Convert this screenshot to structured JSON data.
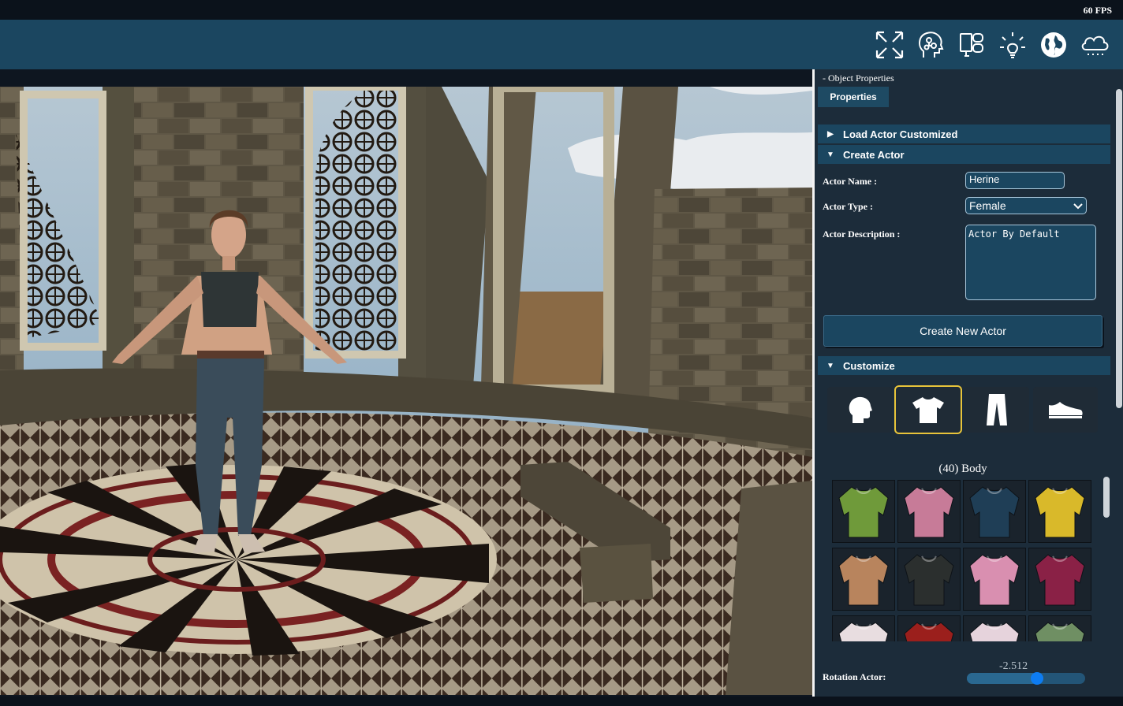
{
  "status": {
    "fps": "60 FPS"
  },
  "toolbar": {
    "tools": [
      {
        "name": "fullscreen-icon"
      },
      {
        "name": "ai-brain-icon"
      },
      {
        "name": "device-layout-icon"
      },
      {
        "name": "light-bulb-icon"
      },
      {
        "name": "globe-icon"
      },
      {
        "name": "weather-cloud-icon"
      }
    ]
  },
  "panel": {
    "title": "- Object Properties",
    "tab": "Properties",
    "load_actor": "Load Actor Customized",
    "create_actor": "Create Actor",
    "actor_name_label": "Actor Name :",
    "actor_name_value": "Herine",
    "actor_type_label": "Actor Type :",
    "actor_type_value": "Female",
    "actor_desc_label": "Actor Description :",
    "actor_desc_value": "Actor By Default",
    "create_button": "Create New Actor",
    "customize": "Customize",
    "categories": [
      "head-icon",
      "shirt-icon",
      "pants-icon",
      "shoe-icon"
    ],
    "active_category": 1,
    "body_count": "(40) Body",
    "clothes": [
      {
        "color": "#6f9a3a"
      },
      {
        "color": "#c77b98"
      },
      {
        "color": "#1f3e56"
      },
      {
        "color": "#d9b92a"
      },
      {
        "color": "#b8845d"
      },
      {
        "color": "#2b2f2e"
      },
      {
        "color": "#d98fb0"
      },
      {
        "color": "#8a2146"
      },
      {
        "color": "#e8dde0"
      },
      {
        "color": "#9b1f1c"
      },
      {
        "color": "#e6d3dc"
      },
      {
        "color": "#6f8f63"
      }
    ],
    "rotation_label": "Rotation Actor:",
    "rotation_value": "-2.512",
    "rotation_fraction": 0.59
  },
  "colors": {
    "toolbar": "#1b4660",
    "panel": "#1c2c3a",
    "accent": "#e8c43a",
    "slider_knob": "#0d7cf2"
  }
}
